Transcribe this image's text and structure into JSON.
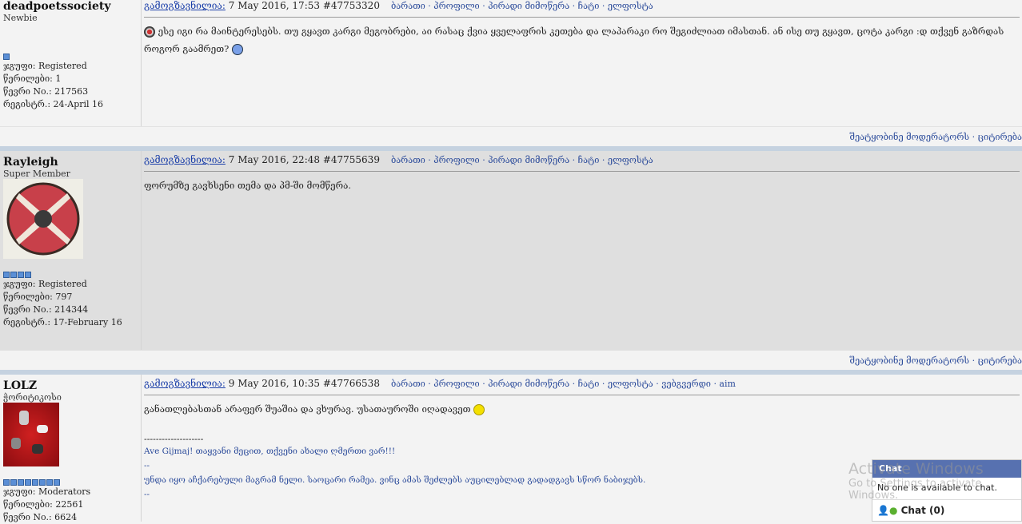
{
  "posts": [
    {
      "username": "deadpoetssociety",
      "rank": "Newbie",
      "pips": 1,
      "group": "ჯგუფი: Registered",
      "posts": "წერილები: 1",
      "member_no": "წევრი No.: 217563",
      "registered": "რეგისტრ.: 24-April 16",
      "sent_label": "გამოგზავნილია:",
      "date": " 7 May 2016, 17:53  #47753320",
      "links": "ბარათი · პროფილი · პირადი მიმოწერა · ჩატი · ელფოსტა",
      "body": "ესე იგი რა მაინტერესებს. თუ გყავთ კარგი მეგობრები, აი რასაც ქვია ყველაფრის კეთება და ლაპარაკი რო შეგიძლიათ იმასთან. ან ისე თუ გყავთ, ცოტა კარგი :დ თქვენ გაზრდას როგორ გაამრეთ?",
      "footer": "შეატყობინე მოდერატორს  · ციტირება"
    },
    {
      "username": "Rayleigh",
      "rank": "Super Member",
      "pips": 4,
      "group": "ჯგუფი: Registered",
      "posts": "წერილები: 797",
      "member_no": "წევრი No.: 214344",
      "registered": "რეგისტრ.: 17-February 16",
      "sent_label": "გამოგზავნილია:",
      "date": " 7 May 2016, 22:48  #47755639",
      "links": "ბარათი · პროფილი · პირადი მიმოწერა · ჩატი · ელფოსტა",
      "body": "ფორუმზე გავხსენი თემა და პმ-ში მომწერა.",
      "footer": "შეატყობინე მოდერატორს  · ციტირება"
    },
    {
      "username": "LOLZ",
      "rank": "ჭორიტიკოსი",
      "pips": 8,
      "group": "ჯგუფი: Moderators",
      "posts": "წერილები: 22561",
      "member_no": "წევრი No.: 6624",
      "sent_label": "გამოგზავნილია:",
      "date": " 9 May 2016, 10:35  #47766538",
      "links": "ბარათი · პროფილი · პირადი მიმოწერა · ჩატი · ელფოსტა · ვებგვერდი · aim",
      "body": "განათლებასთან არაფერ შუაშია და ვხურავ. უსათაუროში იღადავეთ",
      "sig_sep": "--------------------",
      "sig1": "Ave Gijmaj! თაყვანი მეცით, თქვენი ახალი ღმერთი ვარ!!!",
      "sig_dash": "--",
      "sig2": "უნდა იყო აჩქარებული მაგრამ ნელი. საოცარი რამეა. ვინც ამას შეძლებს აუცილებლად გადადგავს სწორ ნაბიჯებს.",
      "sig_dash2": "--"
    }
  ],
  "chat": {
    "title": "Chat",
    "empty": "No one is available to chat.",
    "footer": "Chat (0)"
  },
  "watermark": {
    "line1": "Activate Windows",
    "line2": "Go to Settings to activate Windows."
  }
}
